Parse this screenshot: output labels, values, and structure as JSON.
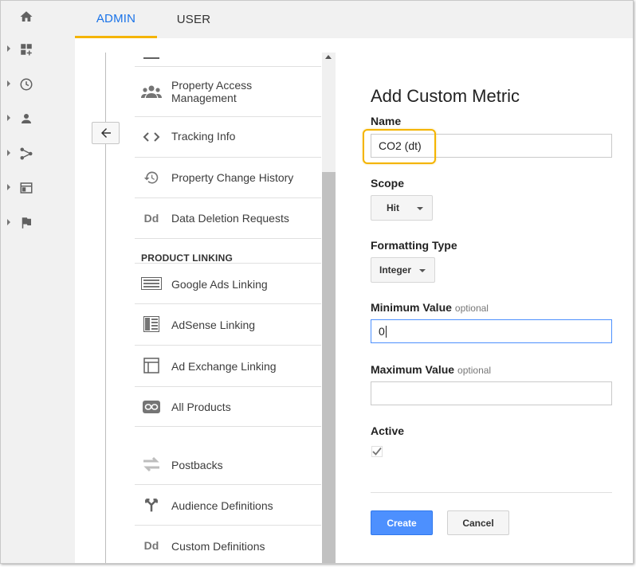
{
  "rail": {
    "items": [
      {
        "icon": "home-icon",
        "has_caret": false
      },
      {
        "icon": "dashboard-icon",
        "has_caret": true
      },
      {
        "icon": "clock-icon",
        "has_caret": true
      },
      {
        "icon": "person-icon",
        "has_caret": true
      },
      {
        "icon": "acquisition-icon",
        "has_caret": true
      },
      {
        "icon": "behavior-icon",
        "has_caret": true
      },
      {
        "icon": "flag-icon",
        "has_caret": true
      }
    ]
  },
  "tabs": {
    "admin": "ADMIN",
    "user": "USER",
    "active_color": "#1a73e8",
    "underline_color": "#f4b400"
  },
  "nav": {
    "items": [
      {
        "label": "Property Access Management",
        "line1": "Property Access",
        "line2": "Management",
        "icon": "people-icon"
      },
      {
        "label": "Tracking Info",
        "icon": "code-icon"
      },
      {
        "label": "Property Change History",
        "icon": "history-icon"
      },
      {
        "label": "Data Deletion Requests",
        "icon": "dd-icon",
        "icon_text": "Dd"
      },
      {
        "label": "Google Ads Linking",
        "icon": "google-ads-icon"
      },
      {
        "label": "AdSense Linking",
        "icon": "adsense-icon"
      },
      {
        "label": "Ad Exchange Linking",
        "icon": "ad-exchange-icon"
      },
      {
        "label": "All Products",
        "icon": "link-icon"
      },
      {
        "label": "Postbacks",
        "icon": "postbacks-icon"
      },
      {
        "label": "Audience Definitions",
        "icon": "audience-icon"
      },
      {
        "label": "Custom Definitions",
        "icon": "dd-icon",
        "icon_text": "Dd"
      }
    ],
    "section_product_linking": "PRODUCT LINKING"
  },
  "form": {
    "title": "Add Custom Metric",
    "name_label": "Name",
    "name_value": "CO2 (dt)",
    "scope_label": "Scope",
    "scope_value": "Hit",
    "formatting_label": "Formatting Type",
    "formatting_value": "Integer",
    "min_label": "Minimum Value",
    "min_optional": "optional",
    "min_value": "0",
    "max_label": "Maximum Value",
    "max_optional": "optional",
    "max_value": "",
    "active_label": "Active",
    "active_checked": true,
    "create_label": "Create",
    "cancel_label": "Cancel",
    "highlight_color": "#f4b400",
    "primary_color": "#4d90fe"
  }
}
